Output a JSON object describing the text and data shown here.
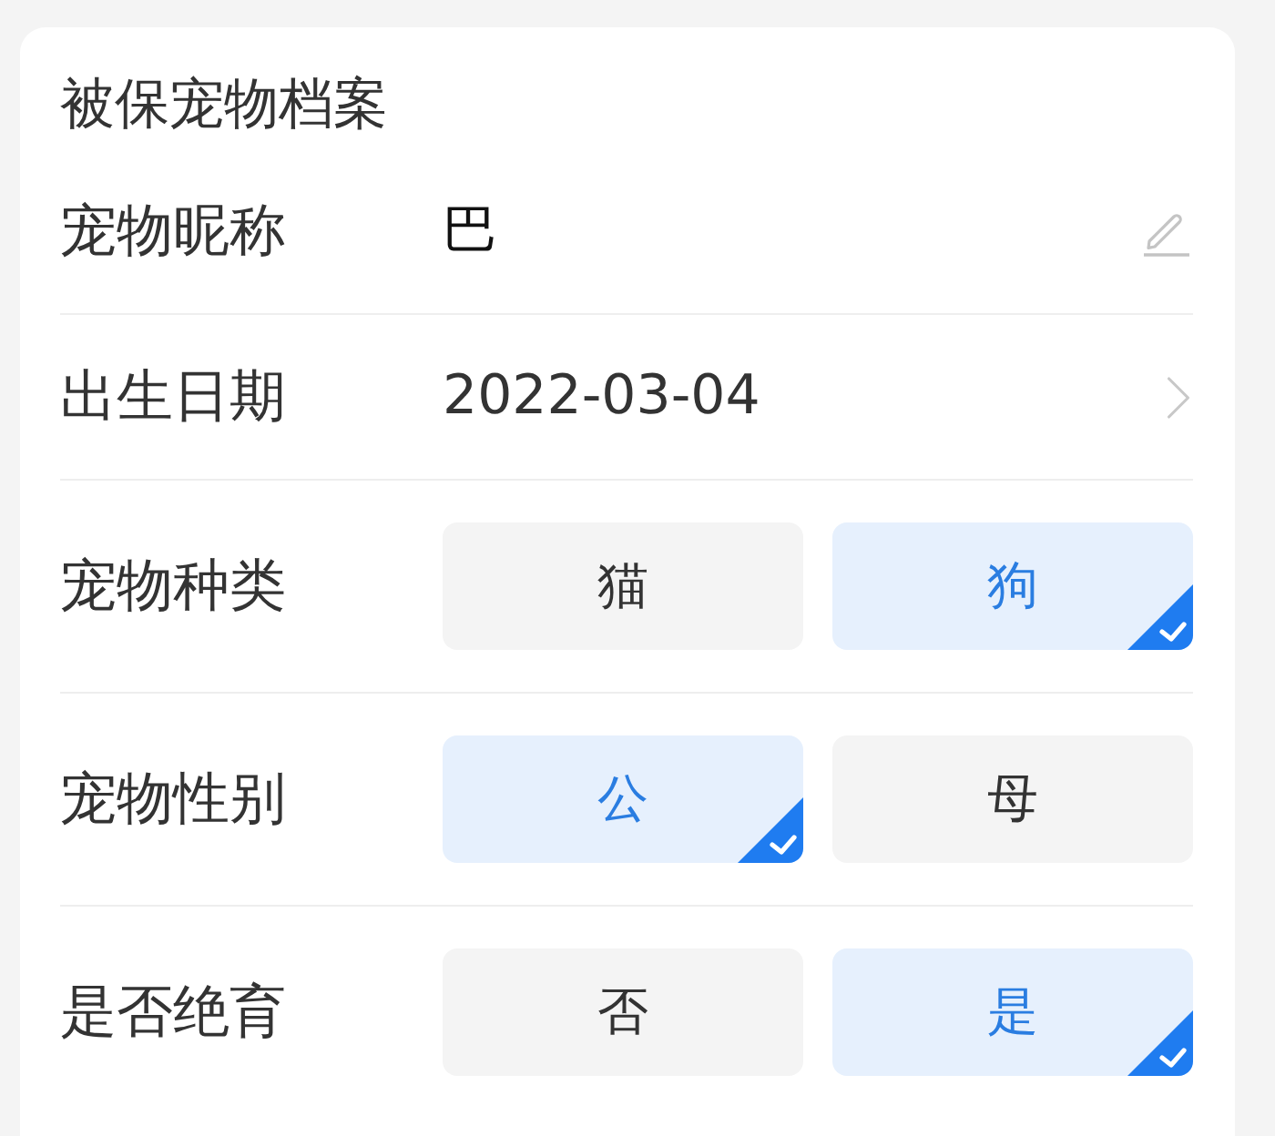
{
  "card": {
    "title": "被保宠物档案"
  },
  "fields": [
    {
      "kind": "text",
      "label": "宠物昵称",
      "value": "巴"
    },
    {
      "kind": "date",
      "label": "出生日期",
      "value": "2022-03-04"
    },
    {
      "kind": "choice",
      "label": "宠物种类",
      "options": [
        {
          "label": "猫",
          "selected": false
        },
        {
          "label": "狗",
          "selected": true
        }
      ]
    },
    {
      "kind": "choice",
      "label": "宠物性别",
      "options": [
        {
          "label": "公",
          "selected": true
        },
        {
          "label": "母",
          "selected": false
        }
      ]
    },
    {
      "kind": "choice",
      "label": "是否绝育",
      "options": [
        {
          "label": "否",
          "selected": false
        },
        {
          "label": "是",
          "selected": true
        }
      ]
    }
  ]
}
